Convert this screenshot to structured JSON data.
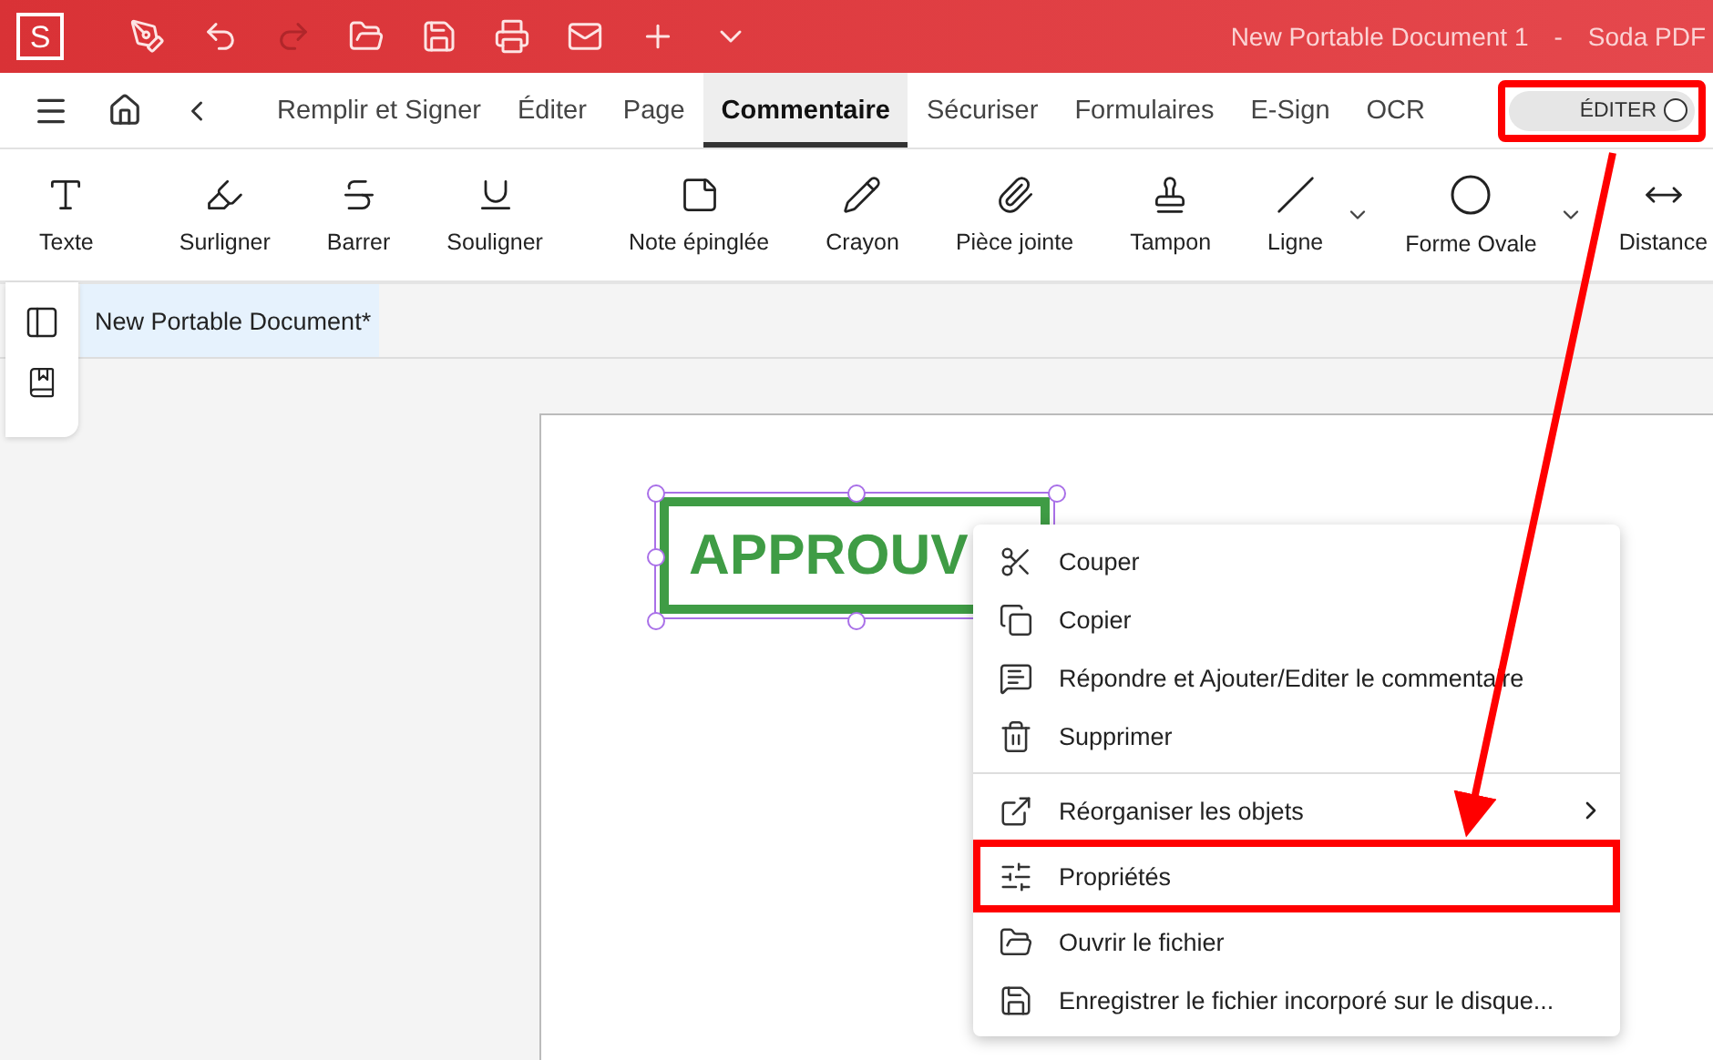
{
  "title_bar": {
    "logo": "S",
    "quick_access": [
      {
        "disabled": false
      },
      {
        "disabled": false
      },
      {
        "disabled": true
      },
      {
        "disabled": false
      },
      {
        "disabled": false
      },
      {
        "disabled": false
      },
      {
        "disabled": false
      },
      {
        "disabled": false
      },
      {
        "disabled": false
      }
    ],
    "document_title": "New Portable Document 1",
    "separator": "-",
    "app_name": "Soda PDF"
  },
  "tabs": [
    {
      "label": "Remplir et Signer",
      "selected": false
    },
    {
      "label": "Éditer",
      "selected": false
    },
    {
      "label": "Page",
      "selected": false
    },
    {
      "label": "Commentaire",
      "selected": true
    },
    {
      "label": "Sécuriser",
      "selected": false
    },
    {
      "label": "Formulaires",
      "selected": false
    },
    {
      "label": "E-Sign",
      "selected": false
    },
    {
      "label": "OCR",
      "selected": false
    }
  ],
  "edit_toggle": {
    "label": "ÉDITER",
    "on": false,
    "highlighted": true
  },
  "toolbar": [
    [
      {
        "label": "Texte",
        "has_dropdown": false
      }
    ],
    [
      {
        "label": "Surligner",
        "has_dropdown": false
      },
      {
        "label": "Barrer",
        "has_dropdown": false
      },
      {
        "label": "Souligner",
        "has_dropdown": false
      }
    ],
    [
      {
        "label": "Note épinglée",
        "has_dropdown": false
      },
      {
        "label": "Crayon",
        "has_dropdown": false
      },
      {
        "label": "Pièce jointe",
        "has_dropdown": false
      },
      {
        "label": "Tampon",
        "has_dropdown": false
      },
      {
        "label": "Ligne",
        "has_dropdown": true
      },
      {
        "label": "Forme Ovale",
        "has_dropdown": true
      },
      {
        "label": "Distance",
        "has_dropdown": false
      }
    ]
  ],
  "document_tab": {
    "label": "New Portable Document*",
    "selected": true
  },
  "stamp": {
    "text": "APPROUV",
    "selected": true
  },
  "context_menu": [
    [
      {
        "label": "Couper",
        "submenu": false,
        "highlighted": false
      },
      {
        "label": "Copier",
        "submenu": false,
        "highlighted": false
      },
      {
        "label": "Répondre et Ajouter/Editer le commentaire",
        "submenu": false,
        "highlighted": false
      },
      {
        "label": "Supprimer",
        "submenu": false,
        "highlighted": false
      }
    ],
    [
      {
        "label": "Réorganiser les objets",
        "submenu": true,
        "highlighted": false
      },
      {
        "label": "Propriétés",
        "submenu": false,
        "highlighted": true
      },
      {
        "label": "Ouvrir le fichier",
        "submenu": false,
        "highlighted": false
      },
      {
        "label": "Enregistrer le fichier incorporé sur le disque...",
        "submenu": false,
        "highlighted": false
      }
    ]
  ]
}
